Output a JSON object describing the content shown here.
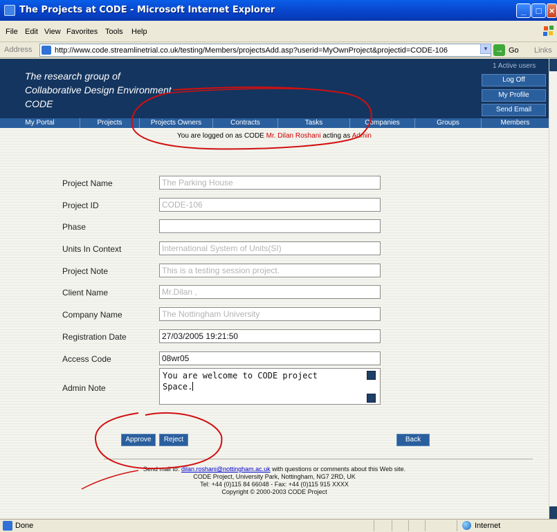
{
  "window": {
    "title": "The Projects at CODE - Microsoft Internet Explorer"
  },
  "menu": [
    "File",
    "Edit",
    "View",
    "Favorites",
    "Tools",
    "Help"
  ],
  "address": {
    "label": "Address",
    "url": "http://www.code.streamlinetrial.co.uk/testing/Members/projectsAdd.asp?userid=MyOwnProject&projectid=CODE-106",
    "go_label": "Go",
    "links_label": "Links"
  },
  "header": {
    "line1": "The research group of",
    "line2": "Collaborative Design Environment",
    "line3": "CODE",
    "active_users": "1 Active users",
    "log_off": "Log Off",
    "my_profile": "My Profile",
    "send_email": "Send Email"
  },
  "nav": [
    "My Portal",
    "Projects",
    "Projects Owners",
    "Contracts",
    "Tasks",
    "Companies",
    "Groups",
    "Members"
  ],
  "logged": {
    "prefix": "You are logged on as CODE ",
    "user": "Mr. Dilan Roshani",
    "middle": "  acting as ",
    "role": "Admin"
  },
  "form": {
    "fields": [
      {
        "label": "Project Name",
        "value": "The Parking House"
      },
      {
        "label": "Project ID",
        "value": "CODE-106"
      },
      {
        "label": "Phase",
        "value": ""
      },
      {
        "label": "Units In Context",
        "value": "International System of Units(SI)"
      },
      {
        "label": "Project Note",
        "value": "This is a testing session project."
      },
      {
        "label": "Client Name",
        "value": "Mr.Dilan ,"
      },
      {
        "label": "Company Name",
        "value": "The Nottingham University"
      },
      {
        "label": "Registration Date",
        "value": "27/03/2005 19:21:50"
      },
      {
        "label": "Access Code",
        "value": "08wr05"
      }
    ],
    "admin_note_label": "Admin Note",
    "admin_note_line1": "You are welcome to CODE project",
    "admin_note_line2": "Space."
  },
  "buttons": {
    "approve": "Approve",
    "reject": "Reject",
    "back": "Back"
  },
  "footer": {
    "mail_prefix": "Send mail to: ",
    "mail_link": "dilan.roshani@nottingham.ac.uk",
    "mail_suffix": " with questions or comments about this Web site.",
    "address": "CODE Project, University Park, Nottingham, NG7 2RD, UK",
    "phone": "Tel: +44 (0)115 84 66048 - Fax: +44 (0)115 915 XXXX",
    "copyright": "Copyright © 2000-2003 CODE Project"
  },
  "status": {
    "text": "Done",
    "zone": "Internet"
  },
  "colors": {
    "header_bg": "#14355f",
    "nav_bg": "#2a5f9e",
    "annotation": "#d01010"
  }
}
